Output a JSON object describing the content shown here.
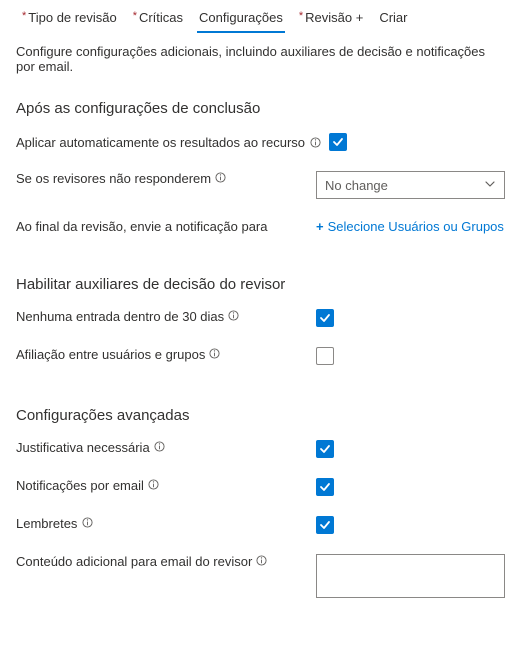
{
  "tabs": {
    "t0": "Tipo de revisão",
    "t1": "Críticas",
    "t2": "Configurações",
    "t3": "Revisão +",
    "t4": "Criar"
  },
  "description": "Configure configurações adicionais, incluindo auxiliares de decisão e notificações por email.",
  "sections": {
    "completion": {
      "title": "Após as configurações de conclusão",
      "auto_apply": "Aplicar automaticamente os resultados ao recurso",
      "no_respond": "Se os revisores não responderem",
      "dropdown_value": "No change",
      "notify": "Ao final da revisão, envie a notificação para",
      "select_link": "Selecione Usuários ou Grupos"
    },
    "helpers": {
      "title": "Habilitar auxiliares de decisão do revisor",
      "no_signin": "Nenhuma entrada dentro de 30 dias",
      "affiliation": "Afiliação entre usuários e grupos"
    },
    "advanced": {
      "title": "Configurações avançadas",
      "justification": "Justificativa necessária",
      "email": "Notificações por email",
      "reminders": "Lembretes",
      "extra_content": "Conteúdo adicional para email do revisor"
    }
  }
}
